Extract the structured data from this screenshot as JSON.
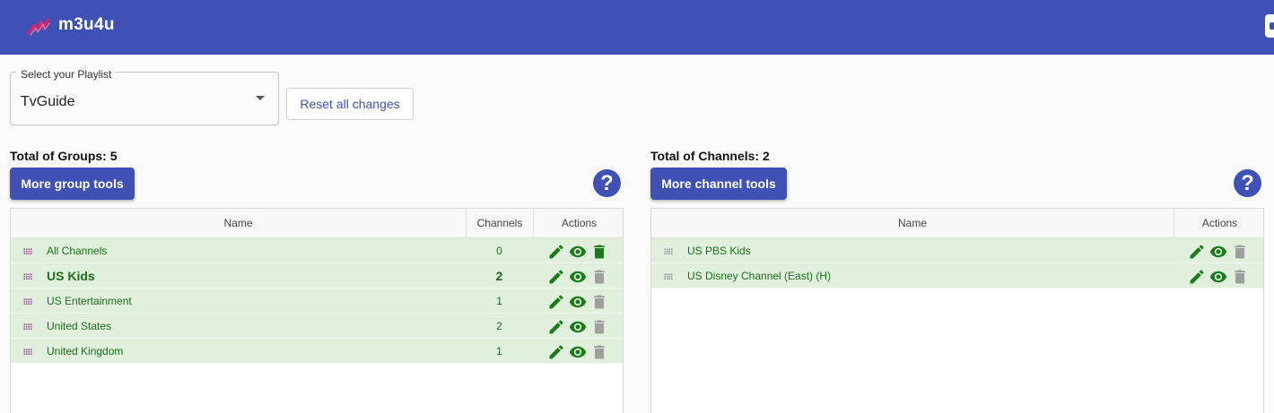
{
  "app": {
    "title": "m3u4u",
    "logo_icon": "zigzag-logo-icon",
    "brand_color": "#3f51b5",
    "logo_color": "#e91e63"
  },
  "playlist_select": {
    "label": "Select your Playlist",
    "value": "TvGuide"
  },
  "reset_button": {
    "label": "Reset all changes"
  },
  "groups": {
    "total_label": "Total of Groups: 5",
    "tools_button": "More group tools",
    "help_symbol": "?",
    "columns": {
      "name": "Name",
      "channels": "Channels",
      "actions": "Actions"
    },
    "rows": [
      {
        "name": "All Channels",
        "channels": "0",
        "bold": false,
        "delete_enabled": true
      },
      {
        "name": "US Kids",
        "channels": "2",
        "bold": true,
        "delete_enabled": false
      },
      {
        "name": "US Entertainment",
        "channels": "1",
        "bold": false,
        "delete_enabled": false
      },
      {
        "name": "United States",
        "channels": "2",
        "bold": false,
        "delete_enabled": false
      },
      {
        "name": "United Kingdom",
        "channels": "1",
        "bold": false,
        "delete_enabled": false
      }
    ]
  },
  "channels": {
    "total_label": "Total of Channels: 2",
    "tools_button": "More channel tools",
    "help_symbol": "?",
    "columns": {
      "name": "Name",
      "actions": "Actions"
    },
    "rows": [
      {
        "name": "US PBS Kids",
        "delete_enabled": false
      },
      {
        "name": "US Disney Channel (East) (H)",
        "delete_enabled": false
      }
    ]
  },
  "colors": {
    "row_bg": "#e0f0dd",
    "row_text": "#1b6e1b",
    "action_green": "#1b7a1b",
    "action_disabled": "#9e9e9e"
  }
}
